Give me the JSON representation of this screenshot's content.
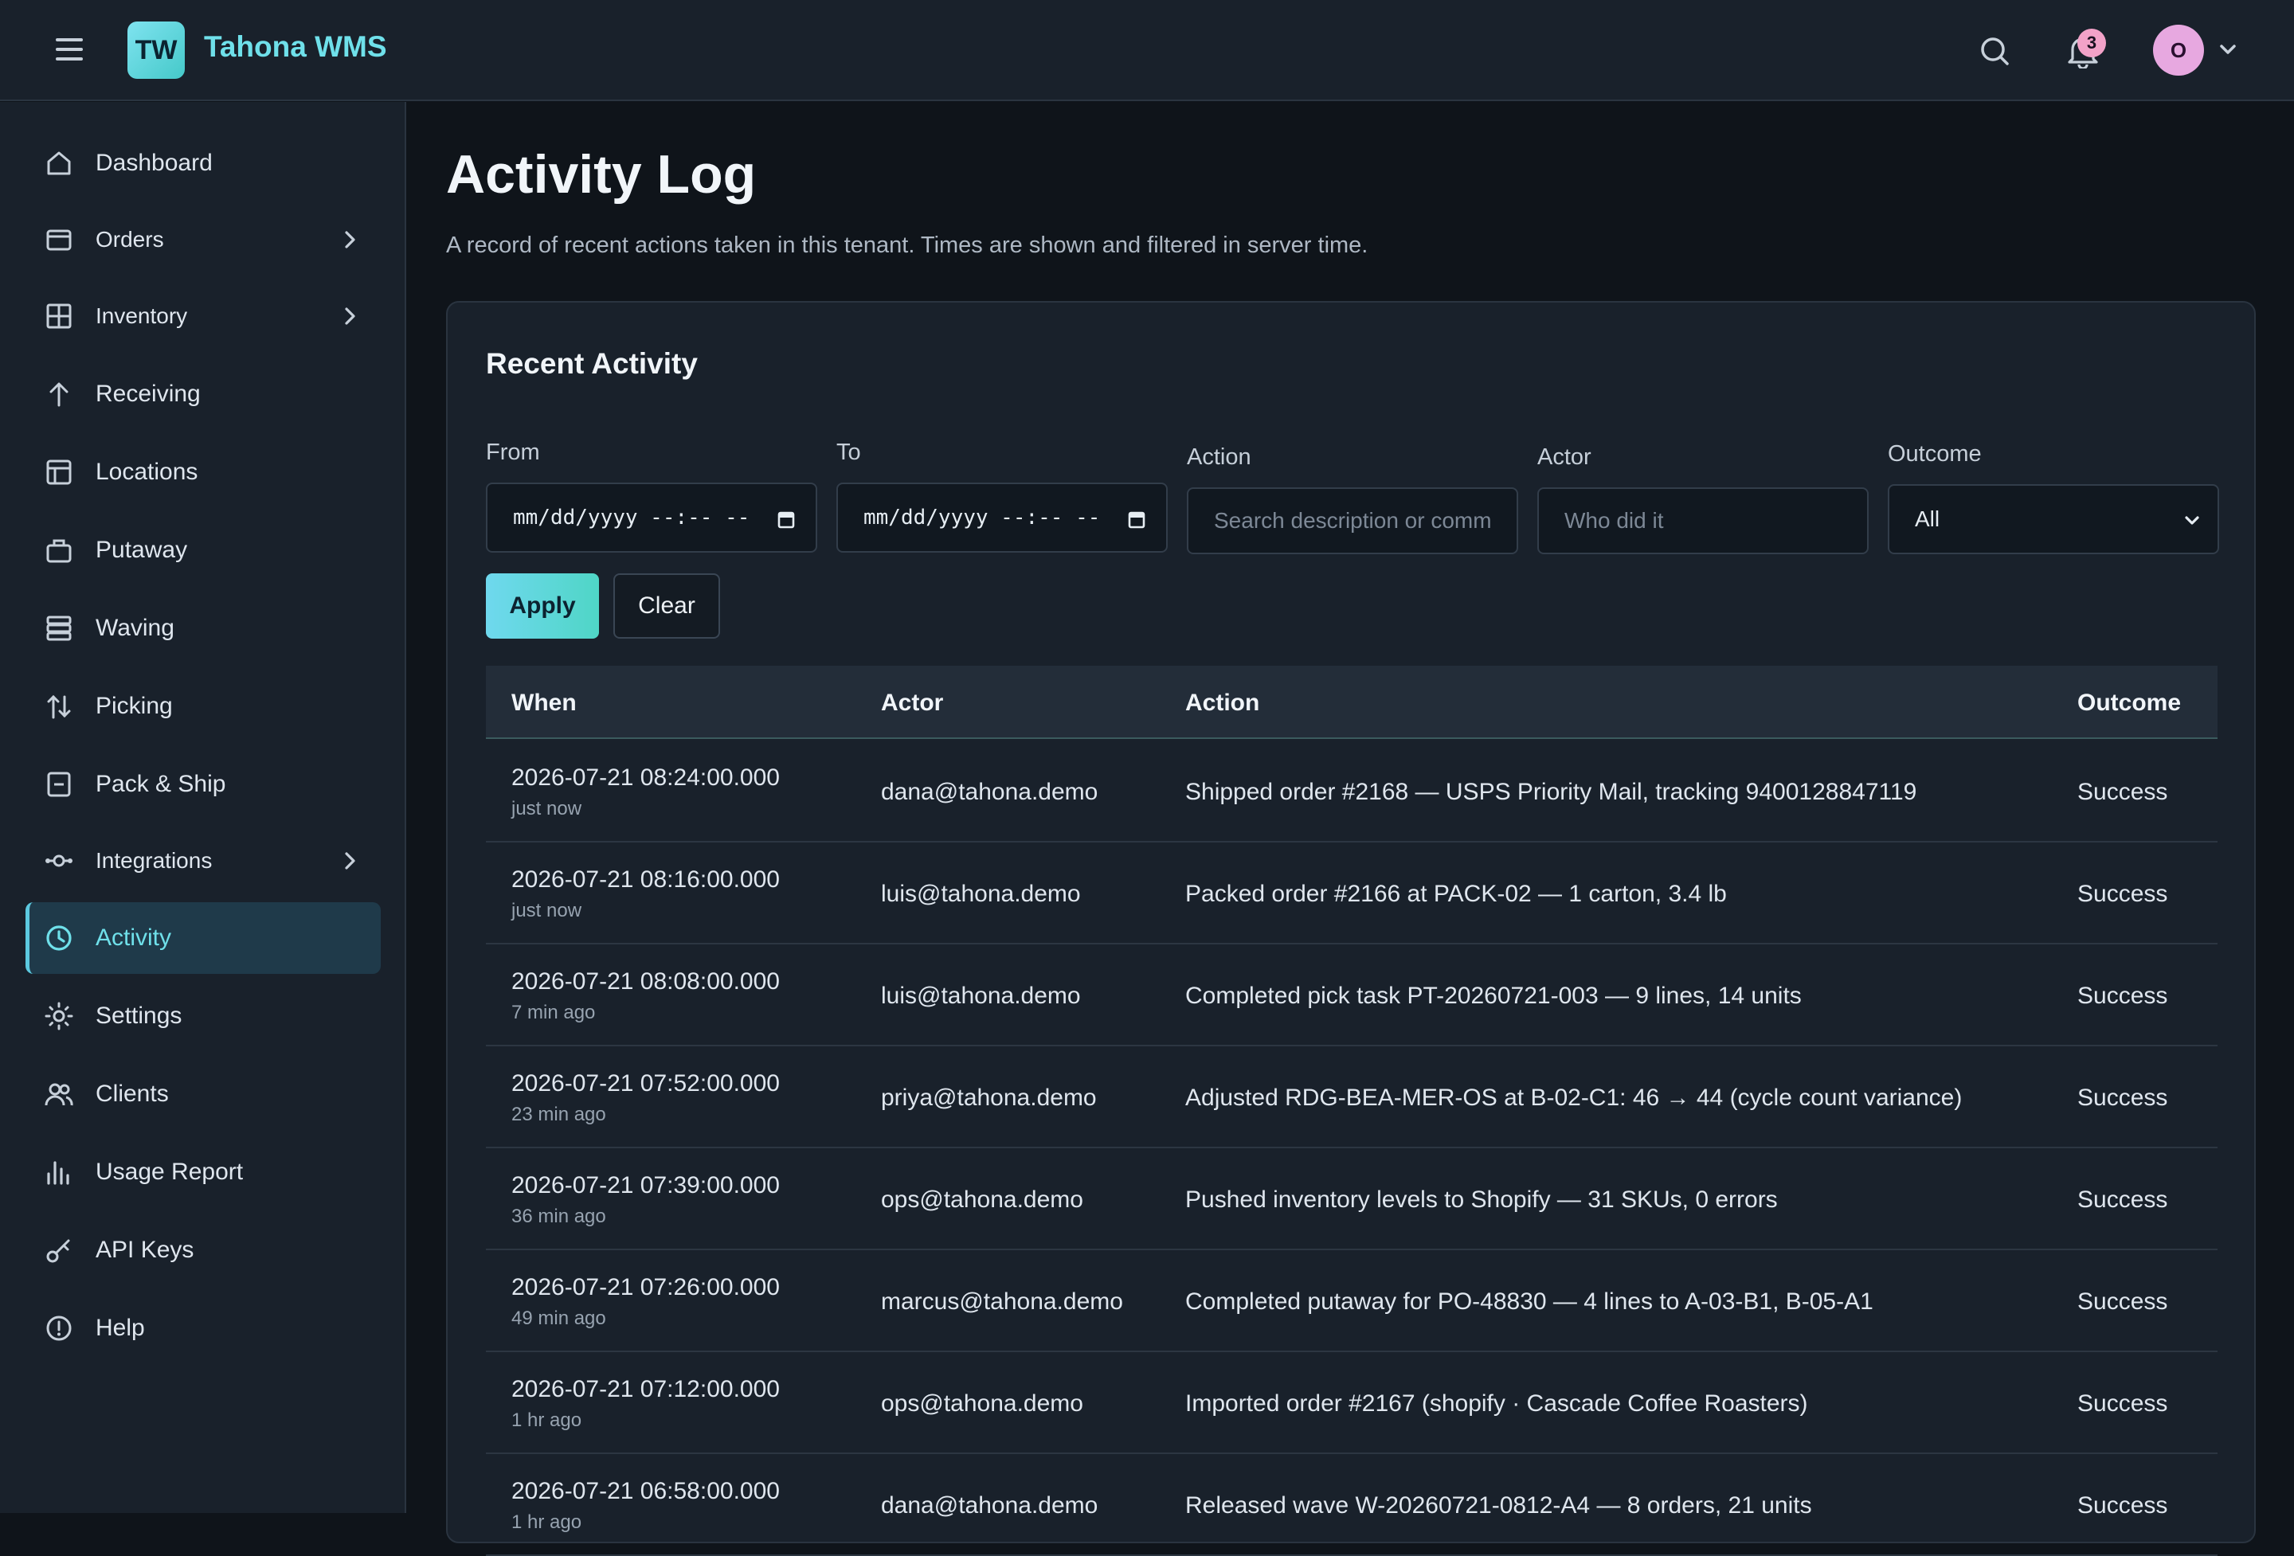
{
  "app": {
    "logo_initials": "TW",
    "name": "Tahona WMS",
    "notification_count": "3",
    "avatar_initial": "O"
  },
  "sidebar": {
    "items": [
      {
        "label": "Dashboard",
        "icon": "home-icon"
      },
      {
        "label": "Orders",
        "icon": "orders-icon",
        "expandable": true
      },
      {
        "label": "Inventory",
        "icon": "grid-icon",
        "expandable": true
      },
      {
        "label": "Receiving",
        "icon": "arrow-up-icon"
      },
      {
        "label": "Locations",
        "icon": "locations-icon"
      },
      {
        "label": "Putaway",
        "icon": "box-icon"
      },
      {
        "label": "Waving",
        "icon": "stack-icon"
      },
      {
        "label": "Picking",
        "icon": "pick-icon"
      },
      {
        "label": "Pack & Ship",
        "icon": "pack-icon"
      },
      {
        "label": "Integrations",
        "icon": "integrations-icon",
        "expandable": true
      },
      {
        "label": "Activity",
        "icon": "clock-icon",
        "active": true
      },
      {
        "label": "Settings",
        "icon": "gear-icon"
      },
      {
        "label": "Clients",
        "icon": "users-icon"
      },
      {
        "label": "Usage Report",
        "icon": "bar-chart-icon"
      },
      {
        "label": "API Keys",
        "icon": "key-icon"
      },
      {
        "label": "Help",
        "icon": "help-icon"
      }
    ]
  },
  "page": {
    "title": "Activity Log",
    "subtitle": "A record of recent actions taken in this tenant. Times are shown and filtered in server time."
  },
  "card": {
    "title": "Recent Activity",
    "filters": {
      "from_label": "From",
      "from_value": "mm/dd/yyyy --:-- --",
      "to_label": "To",
      "to_value": "mm/dd/yyyy --:-- --",
      "action_label": "Action",
      "action_placeholder": "Search description or comm",
      "actor_label": "Actor",
      "actor_placeholder": "Who did it",
      "outcome_label": "Outcome",
      "outcome_value": "All"
    },
    "apply_label": "Apply",
    "clear_label": "Clear",
    "table": {
      "headers": {
        "when": "When",
        "actor": "Actor",
        "action": "Action",
        "outcome": "Outcome"
      },
      "rows": [
        {
          "when": "2026-07-21 08:24:00.000",
          "ago": "just now",
          "actor": "dana@tahona.demo",
          "action": "Shipped order #2168 — USPS Priority Mail, tracking 9400128847119",
          "outcome": "Success"
        },
        {
          "when": "2026-07-21 08:16:00.000",
          "ago": "just now",
          "actor": "luis@tahona.demo",
          "action": "Packed order #2166 at PACK-02 — 1 carton, 3.4 lb",
          "outcome": "Success"
        },
        {
          "when": "2026-07-21 08:08:00.000",
          "ago": "7 min ago",
          "actor": "luis@tahona.demo",
          "action": "Completed pick task PT-20260721-003 — 9 lines, 14 units",
          "outcome": "Success"
        },
        {
          "when": "2026-07-21 07:52:00.000",
          "ago": "23 min ago",
          "actor": "priya@tahona.demo",
          "action": "Adjusted RDG-BEA-MER-OS at B-02-C1: 46 → 44 (cycle count variance)",
          "outcome": "Success"
        },
        {
          "when": "2026-07-21 07:39:00.000",
          "ago": "36 min ago",
          "actor": "ops@tahona.demo",
          "action": "Pushed inventory levels to Shopify — 31 SKUs, 0 errors",
          "outcome": "Success"
        },
        {
          "when": "2026-07-21 07:26:00.000",
          "ago": "49 min ago",
          "actor": "marcus@tahona.demo",
          "action": "Completed putaway for PO-48830 — 4 lines to A-03-B1, B-05-A1",
          "outcome": "Success"
        },
        {
          "when": "2026-07-21 07:12:00.000",
          "ago": "1 hr ago",
          "actor": "ops@tahona.demo",
          "action": "Imported order #2167 (shopify · Cascade Coffee Roasters)",
          "outcome": "Success"
        },
        {
          "when": "2026-07-21 06:58:00.000",
          "ago": "1 hr ago",
          "actor": "dana@tahona.demo",
          "action": "Released wave W-20260721-0812-A4 — 8 orders, 21 units",
          "outcome": "Success"
        }
      ]
    }
  },
  "colors": {
    "accent": "#6fe0ea",
    "background": "#0f141a",
    "panel": "#19212b",
    "active_bg": "#1f3a4a"
  }
}
